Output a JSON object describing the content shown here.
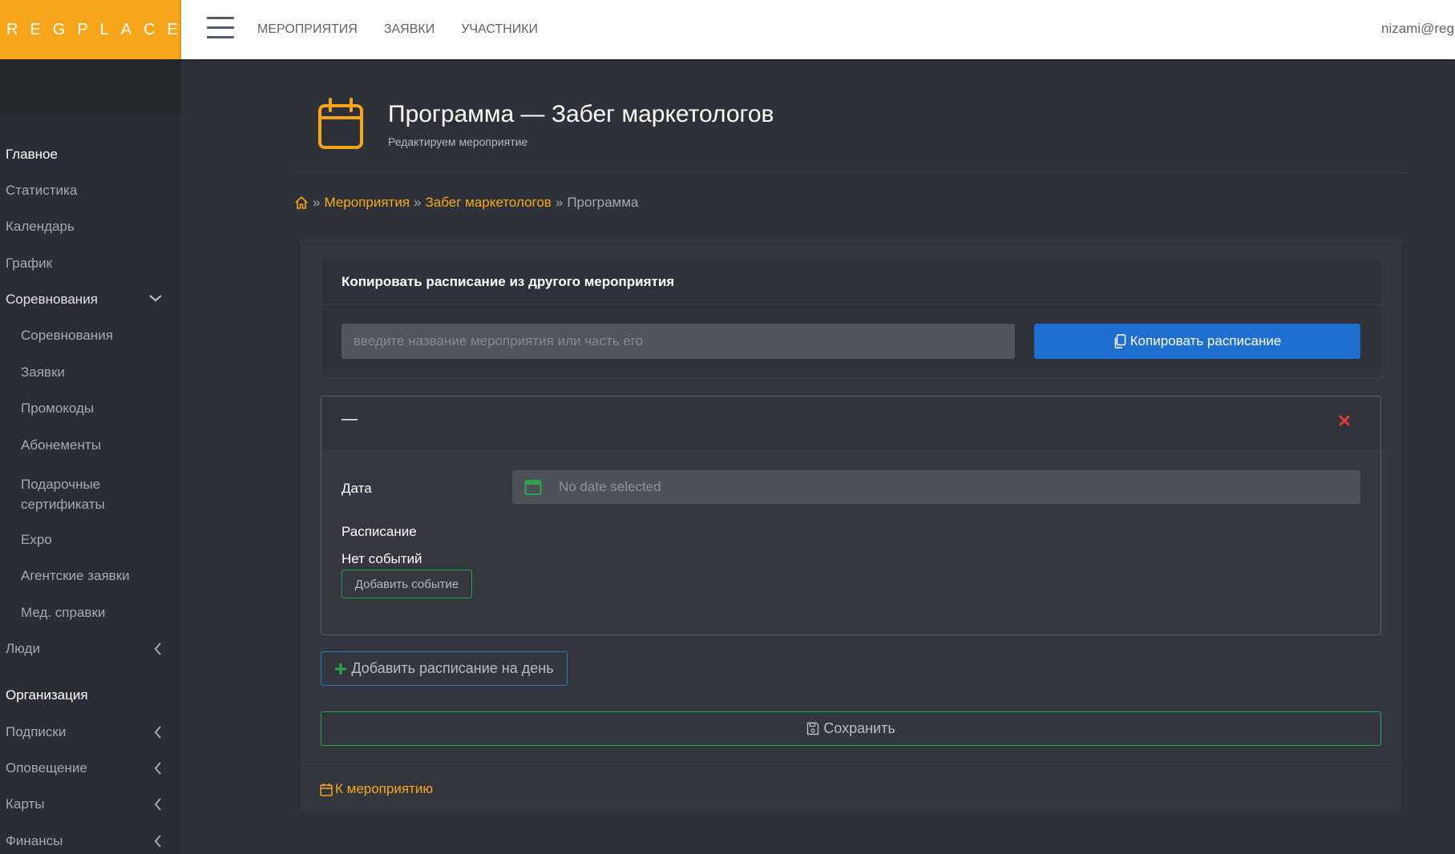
{
  "app": {
    "logo": "REGPLACE"
  },
  "topnav": {
    "items": [
      "МЕРОПРИЯТИЯ",
      "ЗАЯВКИ",
      "УЧАСТНИКИ"
    ],
    "user_email": "nizami@reg"
  },
  "sidebar": {
    "section_main": "Главное",
    "items_main": [
      "Статистика",
      "Календарь",
      "График"
    ],
    "competitions_group": "Соревнования",
    "competitions_sub": [
      "Соревнования",
      "Заявки",
      "Промокоды",
      "Абонементы",
      "Подарочные",
      "сертификаты",
      "Expo",
      "Агентские заявки",
      "Мед. справки"
    ],
    "people": "Люди",
    "section_org": "Организация",
    "items_org": [
      "Подписки",
      "Оповещение",
      "Карты",
      "Финансы"
    ]
  },
  "page": {
    "title": "Программа — Забег маркетологов",
    "subtitle": "Редактируем мероприятие"
  },
  "breadcrumb": {
    "sep": "»",
    "events": "Мероприятия",
    "event": "Забег маркетологов",
    "current": "Программа"
  },
  "copy_schedule": {
    "title": "Копировать расписание из другого мероприятия",
    "input_placeholder": "введите название мероприятия или часть его",
    "button_label": "Копировать расписание"
  },
  "day": {
    "header": "—",
    "date_label": "Дата",
    "date_placeholder": "No date selected",
    "schedule_label": "Расписание",
    "no_events": "Нет событий",
    "add_event_label": "Добавить событие"
  },
  "actions": {
    "add_day_label": "Добавить расписание на день",
    "save_label": "Сохранить",
    "back_label": "К мероприятию"
  },
  "colors": {
    "accent": "#f7a61c",
    "primary_button": "#1f6fd0",
    "success_border": "#27a35a",
    "close": "#e53935"
  }
}
